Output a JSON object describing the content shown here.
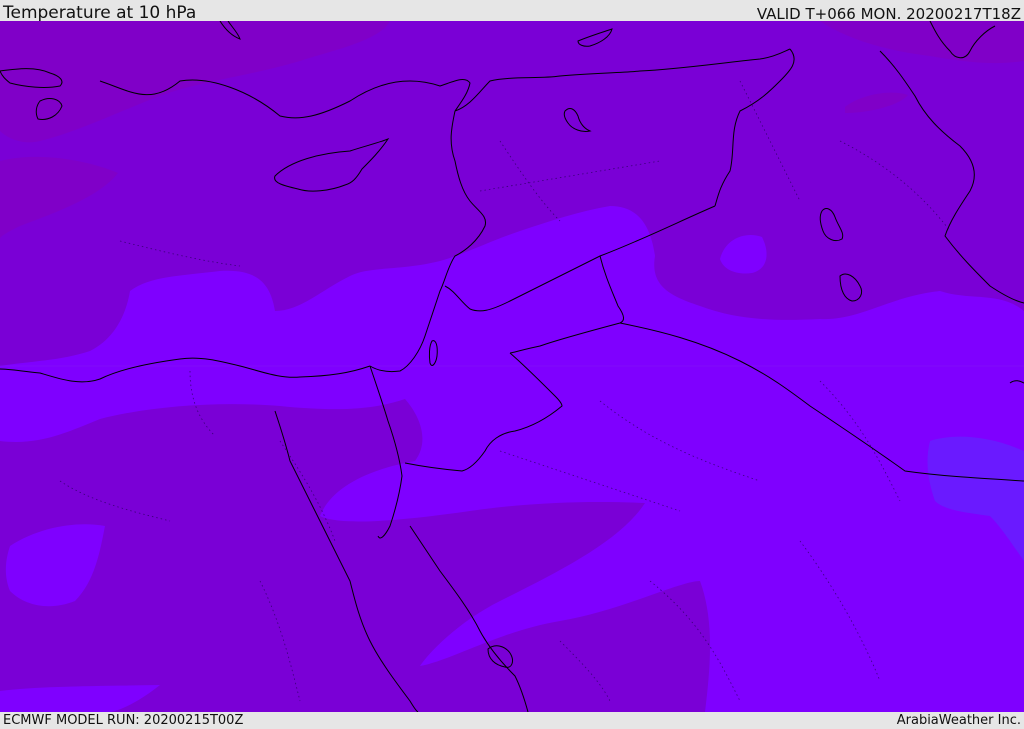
{
  "header": {
    "title": "Temperature at 10 hPa",
    "valid": "VALID T+066 MON. 20200217T18Z"
  },
  "footer": {
    "model_run": "ECMWF MODEL RUN: 20200215T00Z",
    "credit": "ArabiaWeather Inc."
  },
  "map": {
    "colors": {
      "band_dark": "#7a00d6",
      "band_mid": "#7d00e6",
      "band_bright": "#7f00ff",
      "band_blue": "#6a1aff",
      "band_warm": "#8000c8",
      "coastline": "#000000"
    }
  }
}
